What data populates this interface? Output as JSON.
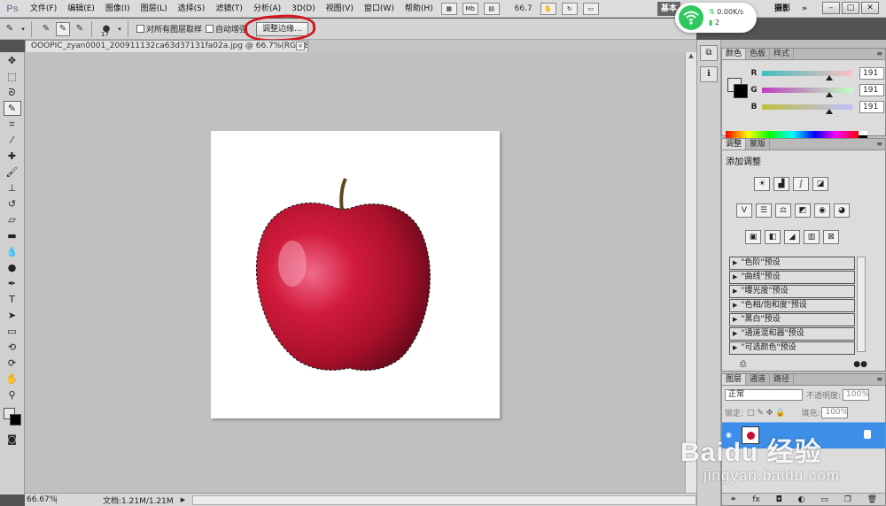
{
  "app": {
    "logo": "Ps"
  },
  "menu": [
    "文件(F)",
    "编辑(E)",
    "图像(I)",
    "图层(L)",
    "选择(S)",
    "滤镜(T)",
    "分析(A)",
    "3D(D)",
    "视图(V)",
    "窗口(W)",
    "帮助(H)"
  ],
  "menubar": {
    "zoom": "66.7",
    "workspace": "基本",
    "design": "摄影",
    "more": "»",
    "mb_label": "Mb",
    "win_min": "–",
    "win_max": "□",
    "win_close": "✕"
  },
  "network": {
    "speed": "0.00K/s",
    "devices": "2",
    "color": "#2ec95c"
  },
  "options": {
    "brush_size": "17",
    "sample_all_layers": "对所有图层取样",
    "auto_enhance": "自动增强",
    "refine_edge": "调整边缘..."
  },
  "document": {
    "tab_title": "OOOPIC_zyan0001_200911132ca63d37131fa02a.jpg @ 66.7%(RGB/8#)",
    "close": "×"
  },
  "status": {
    "zoom": "66.67%",
    "doc_size": "文档:1.21M/1.21M",
    "arrow": "▶"
  },
  "panels": {
    "color": {
      "tabs": [
        "颜色",
        "色板",
        "样式"
      ],
      "R": {
        "label": "R",
        "value": "191"
      },
      "G": {
        "label": "G",
        "value": "191"
      },
      "B": {
        "label": "B",
        "value": "191"
      },
      "value_fraction": 0.749
    },
    "adjustments": {
      "tabs": [
        "调整",
        "蒙版"
      ],
      "title": "添加调整",
      "presets": [
        "\"色阶\"预设",
        "\"曲线\"预设",
        "\"曝光度\"预设",
        "\"色相/饱和度\"预设",
        "\"黑白\"预设",
        "\"通道混和器\"预设",
        "\"可选颜色\"预设"
      ]
    },
    "layers": {
      "tabs": [
        "图层",
        "通道",
        "路径"
      ],
      "blend_mode": "正常",
      "opacity_label": "不透明度:",
      "opacity": "100%",
      "lock_label": "锁定:",
      "fill_label": "填充:",
      "fill": "100%"
    }
  },
  "watermark": {
    "main": "Baidu 经验",
    "sub": "jingyan.baidu.com"
  },
  "colors": {
    "highlight_circle": "#d6141b",
    "layer_selected": "#3c8ee8",
    "apple": "#c8102e"
  }
}
